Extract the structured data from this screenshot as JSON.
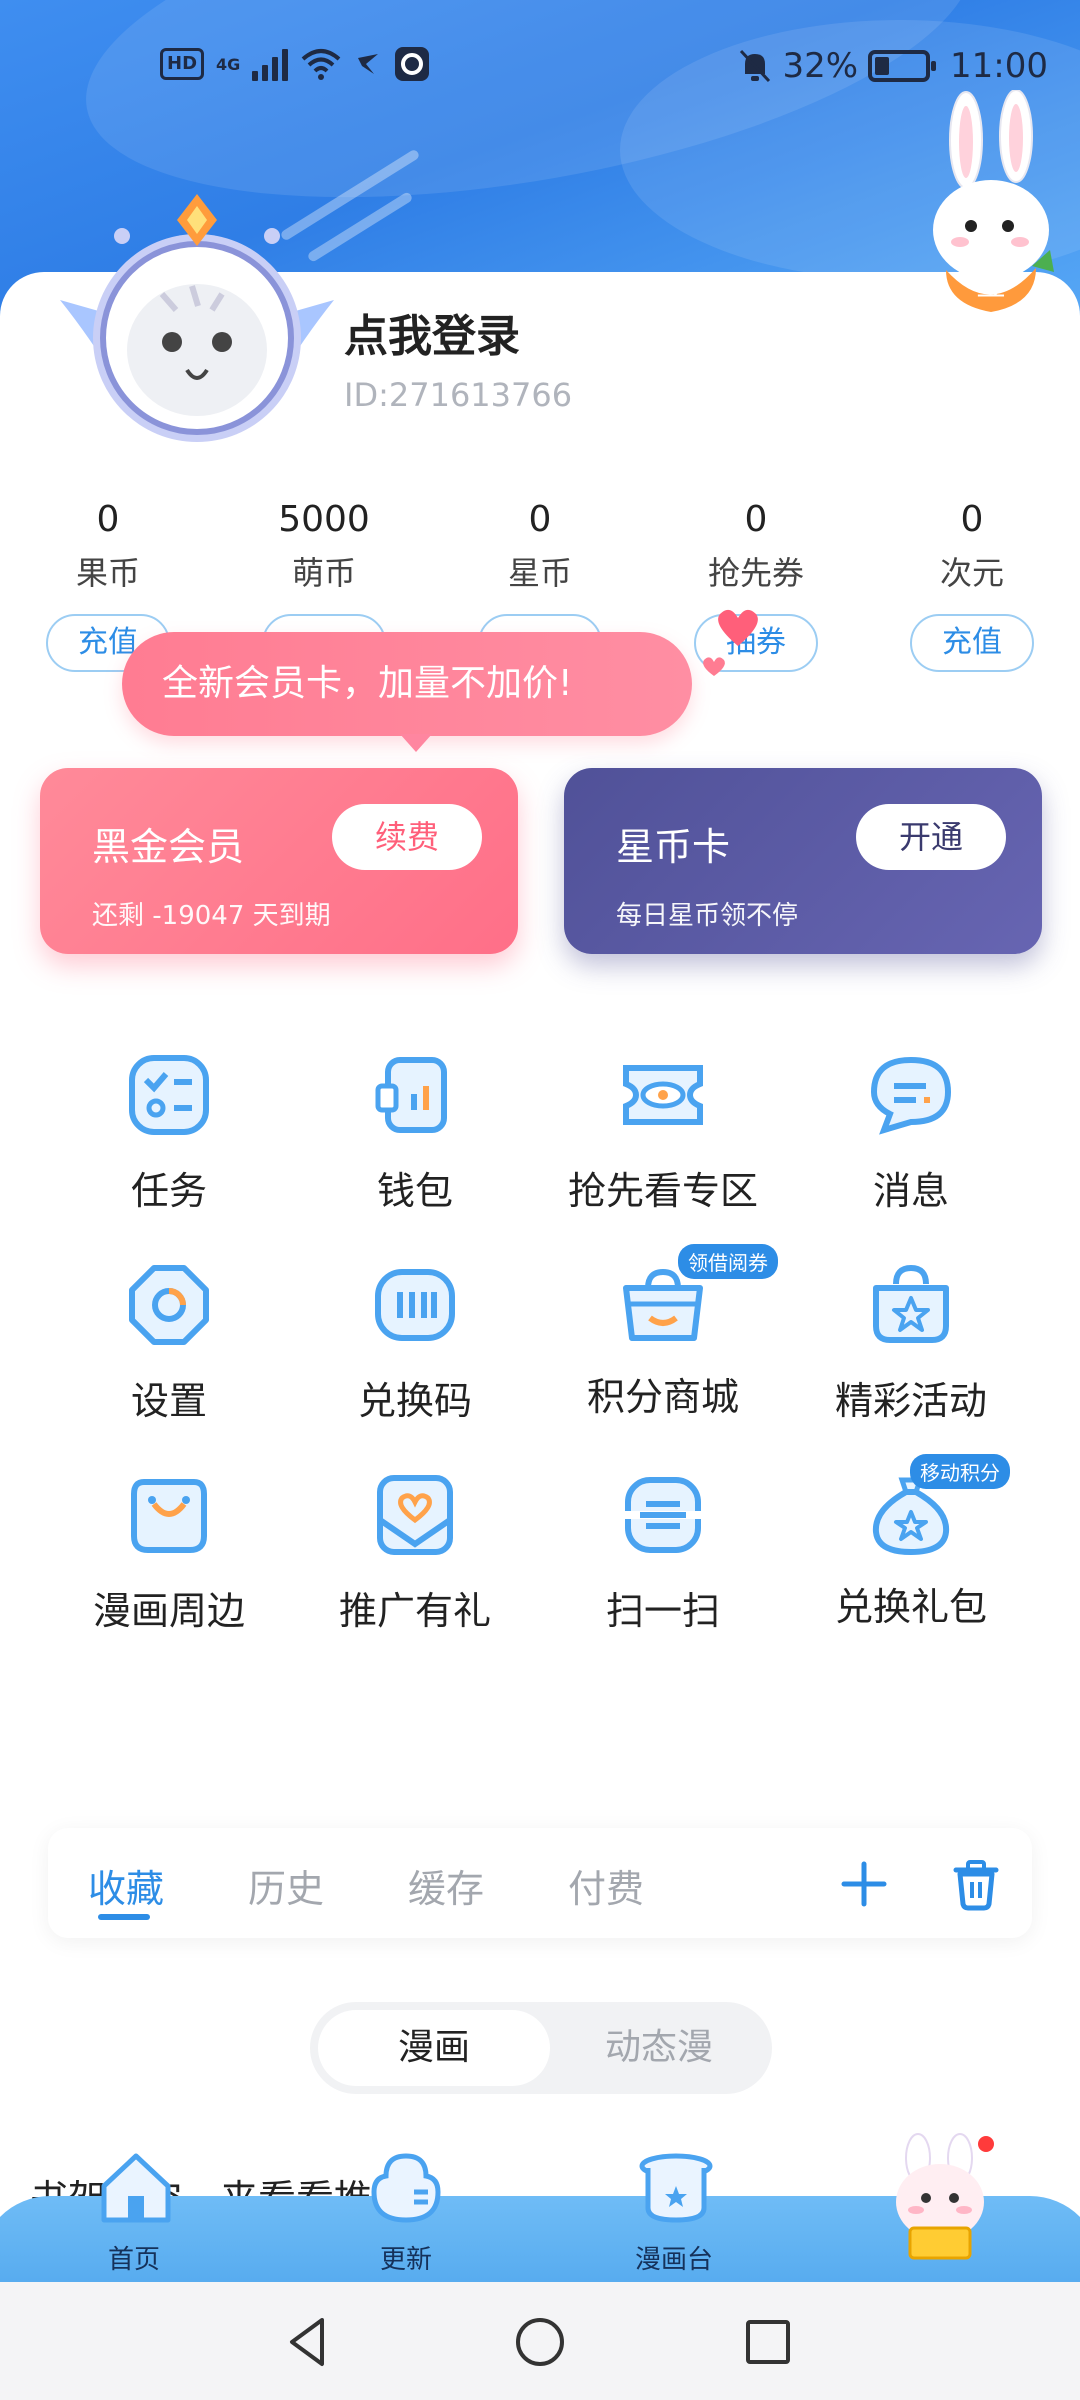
{
  "status_bar": {
    "network": "4G",
    "hd": "HD",
    "battery": "32%",
    "time": "11:00"
  },
  "profile": {
    "login_text": "点我登录",
    "user_id": "ID:271613766"
  },
  "stats": [
    {
      "value": "0",
      "label": "果币",
      "button": "充值"
    },
    {
      "value": "5000",
      "label": "萌币",
      "button": ""
    },
    {
      "value": "0",
      "label": "星币",
      "button": ""
    },
    {
      "value": "0",
      "label": "抢先券",
      "button": "抽券"
    },
    {
      "value": "0",
      "label": "次元",
      "button": "充值"
    }
  ],
  "tooltip": "全新会员卡，加量不加价!",
  "member_cards": {
    "black": {
      "title": "黑金会员",
      "subtitle": "还剩 -19047 天到期",
      "button": "续费"
    },
    "star": {
      "title": "星币卡",
      "subtitle": "每日星币领不停",
      "button": "开通"
    }
  },
  "grid": [
    {
      "label": "任务",
      "icon": "task-icon",
      "badge": ""
    },
    {
      "label": "钱包",
      "icon": "wallet-icon",
      "badge": ""
    },
    {
      "label": "抢先看专区",
      "icon": "ticket-eye-icon",
      "badge": ""
    },
    {
      "label": "消息",
      "icon": "message-icon",
      "badge": ""
    },
    {
      "label": "设置",
      "icon": "settings-icon",
      "badge": ""
    },
    {
      "label": "兑换码",
      "icon": "redeem-code-icon",
      "badge": ""
    },
    {
      "label": "积分商城",
      "icon": "points-mall-icon",
      "badge": "领借阅券"
    },
    {
      "label": "精彩活动",
      "icon": "activity-star-icon",
      "badge": ""
    },
    {
      "label": "漫画周边",
      "icon": "merch-bag-icon",
      "badge": ""
    },
    {
      "label": "推广有礼",
      "icon": "promo-heart-icon",
      "badge": ""
    },
    {
      "label": "扫一扫",
      "icon": "scan-icon",
      "badge": ""
    },
    {
      "label": "兑换礼包",
      "icon": "gift-bag-icon",
      "badge": "移动积分"
    }
  ],
  "shelf_tabs": [
    "收藏",
    "历史",
    "缓存",
    "付费"
  ],
  "segment": {
    "on": "漫画",
    "off": "动态漫"
  },
  "peek_text": "书架空空，来看看推荐",
  "bottom_nav": [
    {
      "label": "首页",
      "icon": "home-icon"
    },
    {
      "label": "更新",
      "icon": "update-icon"
    },
    {
      "label": "漫画台",
      "icon": "comic-stage-icon"
    },
    {
      "label": "",
      "icon": "mascot-icon"
    }
  ],
  "colors": {
    "accent": "#2d8de6",
    "pink": "#ff6f88",
    "purple": "#505198"
  }
}
